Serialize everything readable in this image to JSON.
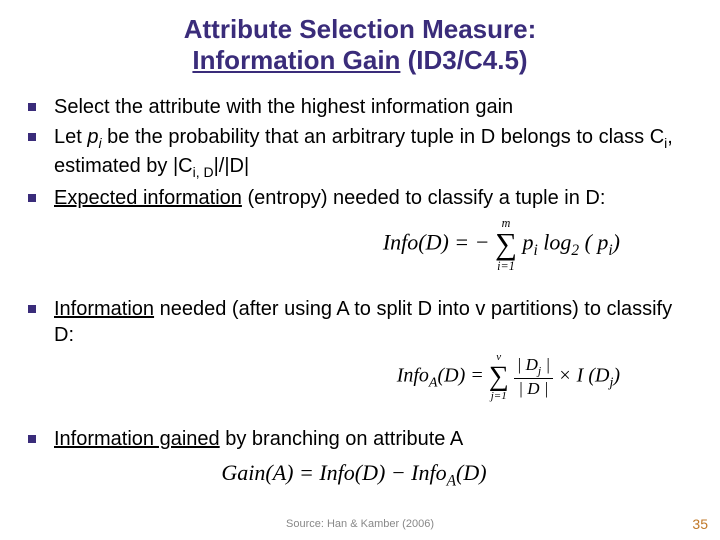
{
  "title": {
    "line1": "Attribute Selection Measure:",
    "line2_a": "Information Gain",
    "line2_b": " (ID3/C4.5)"
  },
  "bullets": {
    "b1": "Select the attribute with the highest information gain",
    "b2_a": "Let ",
    "b2_b": " be the probability that an arbitrary tuple in D belongs to class C",
    "b2_c": ", estimated by |C",
    "b2_d": "|/|D|",
    "b3_a": "Expected information",
    "b3_b": " (entropy) needed to classify a tuple in D:",
    "b4_a": "Information",
    "b4_b": " needed (after using A to split D into v partitions) to classify D:",
    "b5_a": "Information gained",
    "b5_b": " by branching on attribute A"
  },
  "formulas": {
    "f1_left": "Info(D) = −",
    "f1_sum_top": "m",
    "f1_sum_bot": "i=1",
    "f1_right_a": " p",
    "f1_right_b": " log",
    "f1_right_c": "( p",
    "f1_right_d": ")",
    "f2_left": "Info",
    "f2_left2": "(D) = ",
    "f2_sum_top": "v",
    "f2_sum_bot": "j=1",
    "f2_frac_top": "| D",
    "f2_frac_top2": " |",
    "f2_frac_bot": "| D |",
    "f2_right": " × I (D",
    "f2_right2": ")",
    "f3": "Gain(A) = Info(D) − Info",
    "f3_b": "(D)"
  },
  "subs": {
    "i": "i",
    "iD": "i, D",
    "two": "2",
    "A": "A",
    "j": "j"
  },
  "footer": {
    "source": "Source: Han & Kamber (2006)",
    "page": "35"
  }
}
